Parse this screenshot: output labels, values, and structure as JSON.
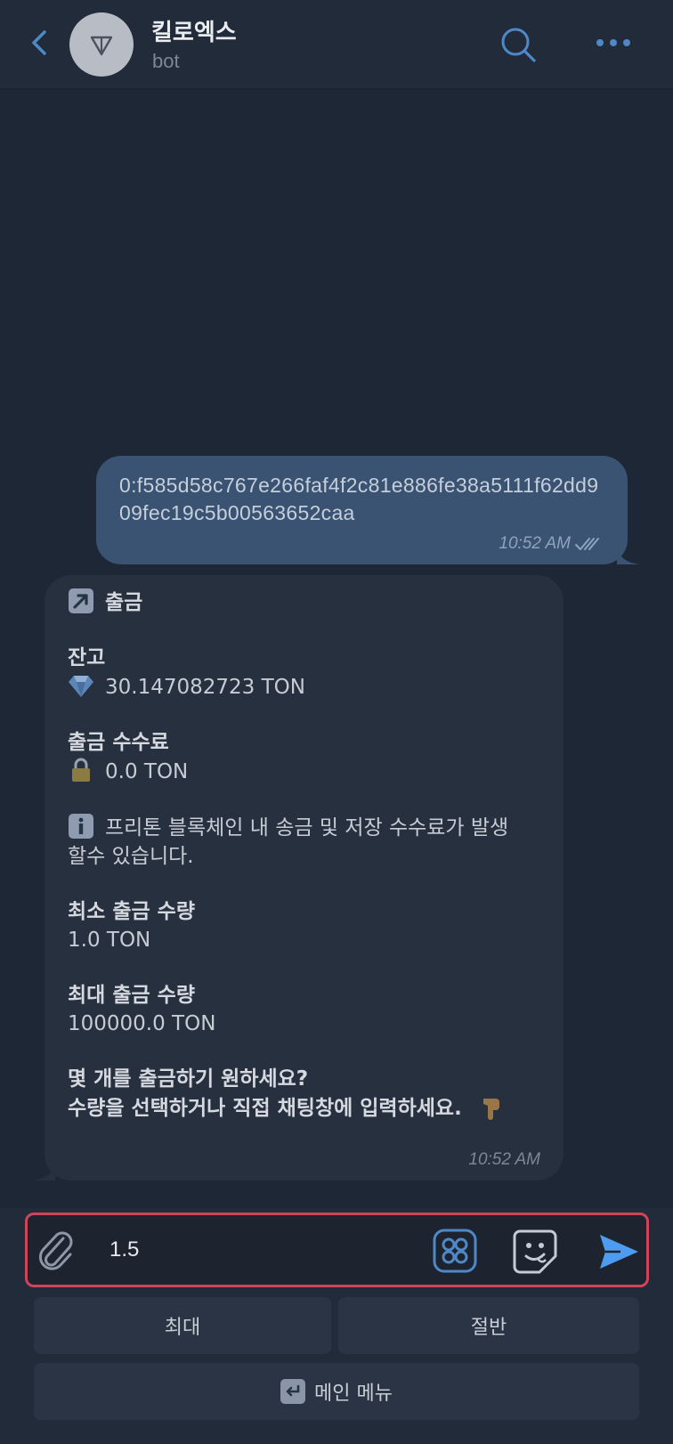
{
  "header": {
    "title": "킬로엑스",
    "subtitle": "bot",
    "accent_color": "#4f88c6"
  },
  "messages": {
    "outgoing": {
      "text": "0:f585d58c767e266faf4f2c81e886fe38a5111f62dd909fec19c5b00563652caa",
      "time": "10:52 AM",
      "status_icon": "double-check-icon"
    },
    "incoming": {
      "title": "출금",
      "title_icon": "up-right-arrow-emoji",
      "balance_label": "잔고",
      "balance_icon": "gem-emoji",
      "balance_value": "30.147082723 TON",
      "fee_label": "출금 수수료",
      "fee_icon": "lock-emoji",
      "fee_value": "0.0 TON",
      "info_icon": "info-emoji",
      "info_text_line1": "프리톤 블록체인 내 송금 및 저장 수수료가 발생",
      "info_text_line2": "할수 있습니다.",
      "min_label": "최소 출금 수량",
      "min_value": "1.0 TON",
      "max_label": "최대 출금 수량",
      "max_value": "100000.0 TON",
      "question_line1": "몇 개를 출금하기 원하세요?",
      "question_line2": "수량을 선택하거나 직접 채팅창에 입력하세요.",
      "question_icon": "pointing-down-emoji",
      "time": "10:52 AM"
    }
  },
  "composer": {
    "value": "1.5",
    "highlight_color": "#d0445a"
  },
  "keyboard": {
    "max_label": "최대",
    "half_label": "절반",
    "menu_label": "메인 메뉴",
    "menu_icon": "return-arrow-emoji"
  }
}
